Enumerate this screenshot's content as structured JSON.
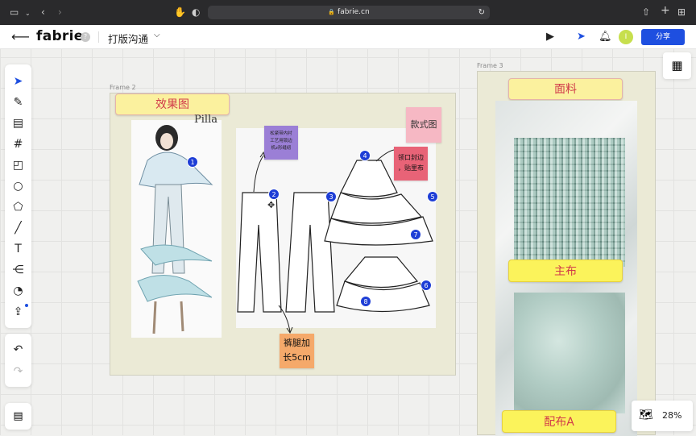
{
  "browser": {
    "url": "fabrie.cn"
  },
  "app": {
    "logo": "fabrie",
    "help": "?",
    "project_title": "打版沟通",
    "share_label": "分享",
    "avatar_initial": "I"
  },
  "canvas": {
    "zoom": "28%",
    "frames": [
      {
        "label": "Frame 2"
      },
      {
        "label": "Frame 3"
      }
    ]
  },
  "frame2": {
    "title_sticky": "效果图",
    "style_sticky": "款式图",
    "note_purple": "松紧带内衬\n工艺用锁边\n机z形缝纫",
    "note_pink": "领口封边\n，贴里布",
    "note_orange": "裤腿加\n长5cm",
    "sketch_text": "Pilla",
    "pins": [
      "1",
      "2",
      "3",
      "4",
      "5",
      "6",
      "7",
      "8"
    ]
  },
  "frame3": {
    "fabric_sticky": "面料",
    "main_fabric": "主布",
    "lining_a": "配布A"
  },
  "colors": {
    "accent": "#1e4fe0",
    "sticky_yellow": "#fbf19e",
    "sticky_red_text": "#d13a4a",
    "pink_note": "#e86377",
    "purple_note": "#9b7fd6",
    "orange_note": "#f5a96a"
  }
}
